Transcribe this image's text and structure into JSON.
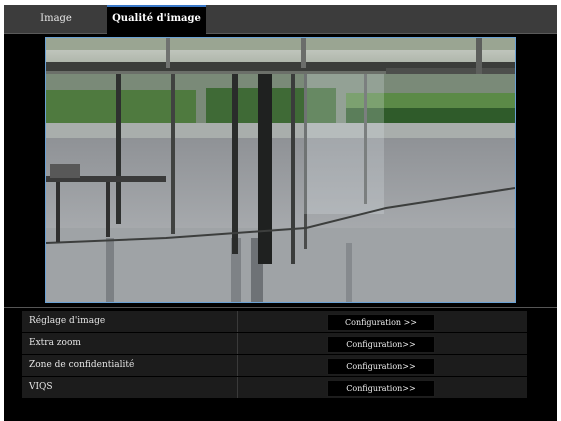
{
  "tabs": [
    {
      "label": "Image"
    },
    {
      "label": "Qualité d'image"
    }
  ],
  "settings": [
    {
      "label": "Réglage d'image",
      "button": "Configuration >>"
    },
    {
      "label": "Extra zoom",
      "button": "Configuration>>"
    },
    {
      "label": "Zone de confidentialité",
      "button": "Configuration>>"
    },
    {
      "label": "VIQS",
      "button": "Configuration>>"
    }
  ],
  "colors": {
    "active_tab_accent": "#3a79c9",
    "preview_border": "#6aa1d4",
    "background": "#000000"
  }
}
